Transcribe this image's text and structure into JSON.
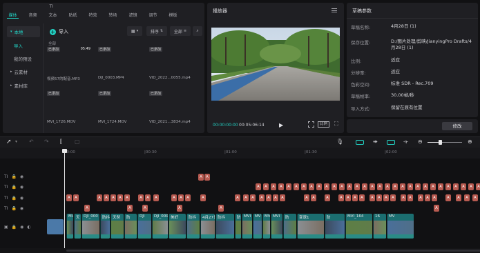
{
  "media_panel": {
    "tabs": [
      {
        "label": "媒体",
        "icon": "media-icon",
        "active": true
      },
      {
        "label": "音频",
        "icon": "audio-icon",
        "active": false
      },
      {
        "label": "文本",
        "icon": "text-icon",
        "active": false
      },
      {
        "label": "贴纸",
        "icon": "sticker-icon",
        "active": false
      },
      {
        "label": "特效",
        "icon": "effects-icon",
        "active": false
      },
      {
        "label": "转场",
        "icon": "transition-icon",
        "active": false
      },
      {
        "label": "滤镜",
        "icon": "filter-icon",
        "active": false
      },
      {
        "label": "调节",
        "icon": "adjust-icon",
        "active": false
      },
      {
        "label": "模板",
        "icon": "template-icon",
        "active": false
      }
    ],
    "sidebar": [
      {
        "label": "本地",
        "selected": true,
        "arrow": "▾"
      },
      {
        "label": "导入",
        "sub": true,
        "highlight": true
      },
      {
        "label": "我的预设",
        "sub": true
      },
      {
        "label": "云素材",
        "arrow": "▸"
      },
      {
        "label": "素材库",
        "arrow": "▸"
      }
    ],
    "import_label": "导入",
    "sort_label": "排序",
    "filter_label": "全部",
    "section_label": "全部",
    "added_badge": "已添加",
    "items": [
      {
        "name": "视频57的配音.MP3",
        "duration": "05:49",
        "kind": "audio"
      },
      {
        "name": "DJI_0003.MP4",
        "kind": "trees"
      },
      {
        "name": "VID_2022...0055.mp4",
        "kind": "rider"
      },
      {
        "name": "MVI_1726.MOV",
        "kind": "pants"
      },
      {
        "name": "MVI_1724.MOV",
        "kind": "road"
      },
      {
        "name": "VID_2021...3834.mp4",
        "kind": "group"
      }
    ]
  },
  "player": {
    "title": "播放器",
    "current_time": "00:00:00:00",
    "total_time": "00:05:06:14",
    "ratio_button": "比例"
  },
  "params": {
    "title": "草稿参数",
    "rows": [
      {
        "label": "草稿名称:",
        "value": "4月28日 (1)"
      },
      {
        "label": "保存位置:",
        "value": "D:/图片处理/剪映/JianyingPro Drafts/4月28日 (1)"
      },
      {
        "label": "比例:",
        "value": "适应"
      },
      {
        "label": "分辨率:",
        "value": "适应"
      },
      {
        "label": "色彩空间:",
        "value": "标准 SDR - Rec.709"
      },
      {
        "label": "草稿帧率:",
        "value": "30.00帧/秒"
      },
      {
        "label": "导入方式:",
        "value": "保留在原有位置"
      }
    ],
    "modify_button": "修改"
  },
  "timeline": {
    "ruler_ticks": [
      "00:00",
      "|00:30",
      "|01:00",
      "|01:30",
      "|02:00"
    ],
    "text_clip_label": "A",
    "track_header": {
      "text_icon": "TI"
    },
    "video_clips": [
      {
        "label": "MV"
      },
      {
        "label": "天"
      },
      {
        "label": "DJI_000"
      },
      {
        "label": "防抖"
      },
      {
        "label": "天然"
      },
      {
        "label": "防"
      },
      {
        "label": "DJI"
      },
      {
        "label": "DJI_0005"
      },
      {
        "label": "美好"
      },
      {
        "label": "防抖"
      },
      {
        "label": "4月27日.mp4"
      },
      {
        "label": "防抖"
      },
      {
        "label": "防"
      },
      {
        "label": "MVI"
      },
      {
        "label": "MV"
      },
      {
        "label": "MVI_1"
      },
      {
        "label": "MVI"
      },
      {
        "label": "防"
      },
      {
        "label": "变速1"
      },
      {
        "label": "防"
      },
      {
        "label": "MVI_164"
      },
      {
        "label": "16"
      },
      {
        "label": "MV"
      }
    ]
  }
}
